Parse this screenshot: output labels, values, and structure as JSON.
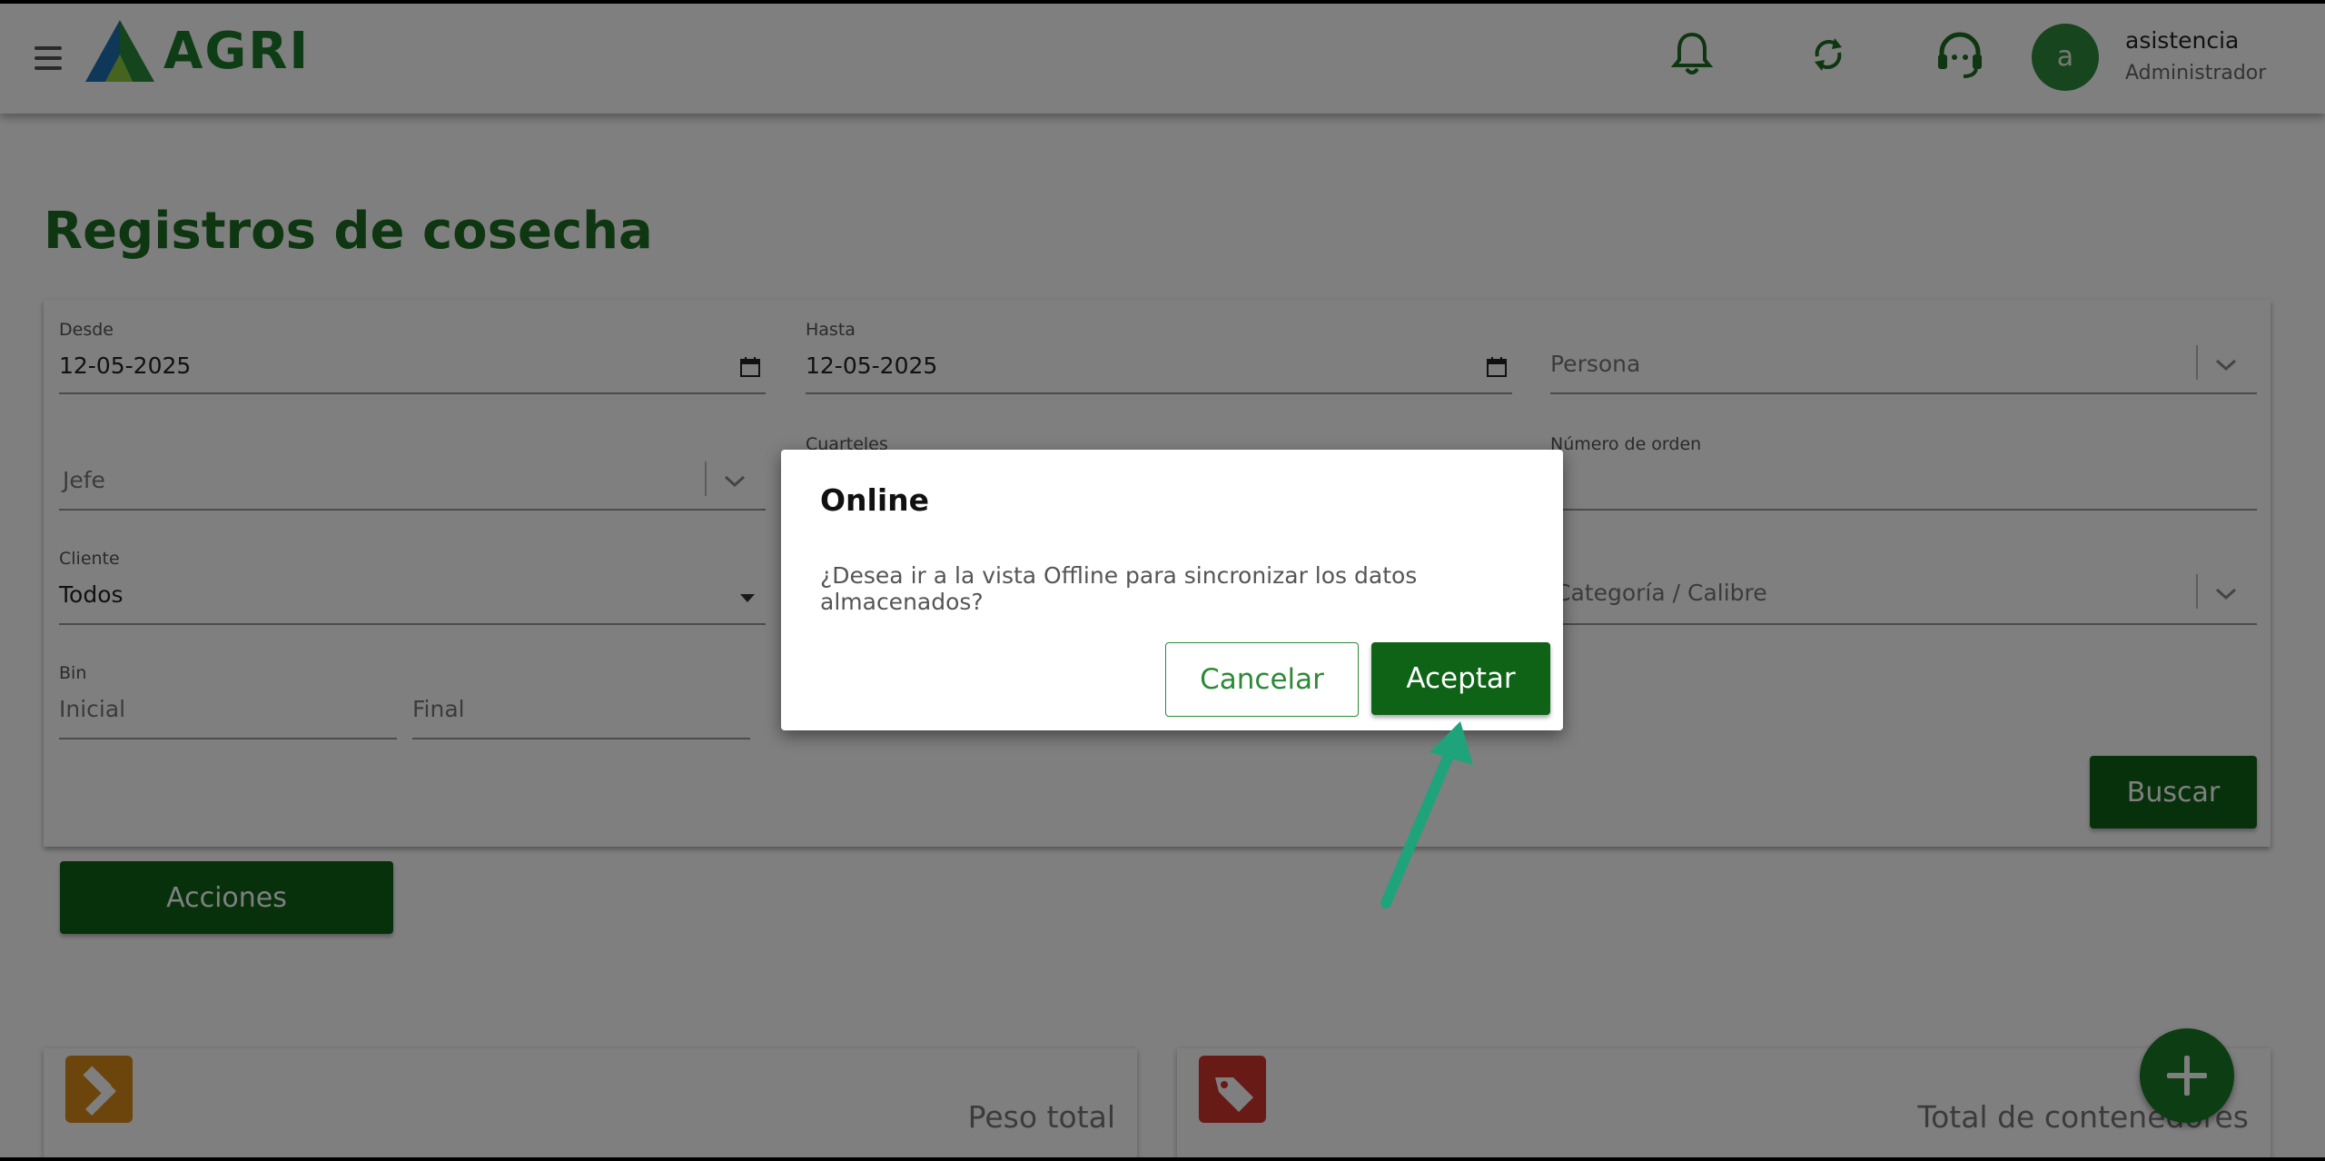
{
  "header": {
    "brand": "AGRI",
    "user": {
      "avatar_letter": "a",
      "name": "asistencia",
      "role": "Administrador"
    },
    "icons": [
      "menu-icon",
      "bell-icon",
      "sync-icon",
      "headset-icon"
    ]
  },
  "page": {
    "title": "Registros de cosecha"
  },
  "filters": {
    "desde": {
      "label": "Desde",
      "value": "12-05-2025"
    },
    "hasta": {
      "label": "Hasta",
      "value": "12-05-2025"
    },
    "persona": {
      "placeholder": "Persona"
    },
    "jefe": {
      "placeholder": "Jefe"
    },
    "cuarteles": {
      "label": "Cuarteles"
    },
    "numero_orden": {
      "label": "Número de orden"
    },
    "cliente": {
      "label": "Cliente",
      "value": "Todos"
    },
    "categoria": {
      "placeholder": "Categoría / Calibre"
    },
    "bin": {
      "label": "Bin",
      "inicial": "Inicial",
      "final": "Final"
    },
    "search_button": "Buscar"
  },
  "actions_button": "Acciones",
  "cards": [
    {
      "label": "Peso total",
      "icon": "hammer-icon",
      "color": "#d98a1a"
    },
    {
      "label": "Total de contenedores",
      "icon": "tag-icon",
      "color": "#d0352f"
    }
  ],
  "modal": {
    "title": "Online",
    "message": "¿Desea ir a la vista Offline para sincronizar los datos almacenados?",
    "cancel": "Cancelar",
    "accept": "Aceptar"
  },
  "colors": {
    "primary": "#0f6317",
    "title": "#1b6d23",
    "annotation_arrow": "#1fa37a"
  }
}
